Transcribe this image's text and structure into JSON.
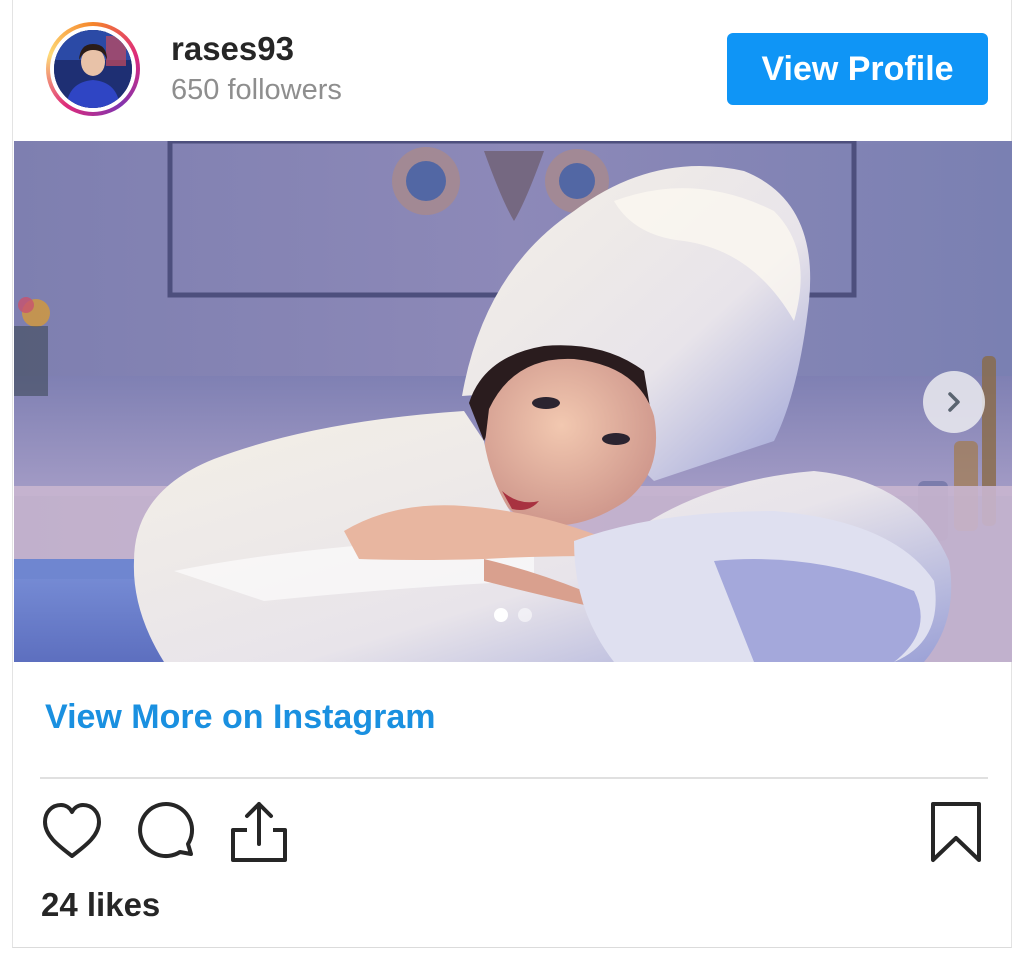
{
  "profile": {
    "username": "rases93",
    "followers": "650 followers",
    "view_profile_label": "View Profile"
  },
  "post": {
    "carousel_total": 2,
    "carousel_current": 1,
    "view_more_label": "View More on Instagram",
    "likes": "24 likes"
  },
  "icons": {
    "like": "heart-icon",
    "comment": "comment-icon",
    "share": "share-icon",
    "save": "bookmark-icon",
    "next": "chevron-right-icon"
  },
  "colors": {
    "accent": "#0f95f6",
    "link": "#1a90e0",
    "text": "#262626",
    "muted": "#8e8e8e"
  }
}
